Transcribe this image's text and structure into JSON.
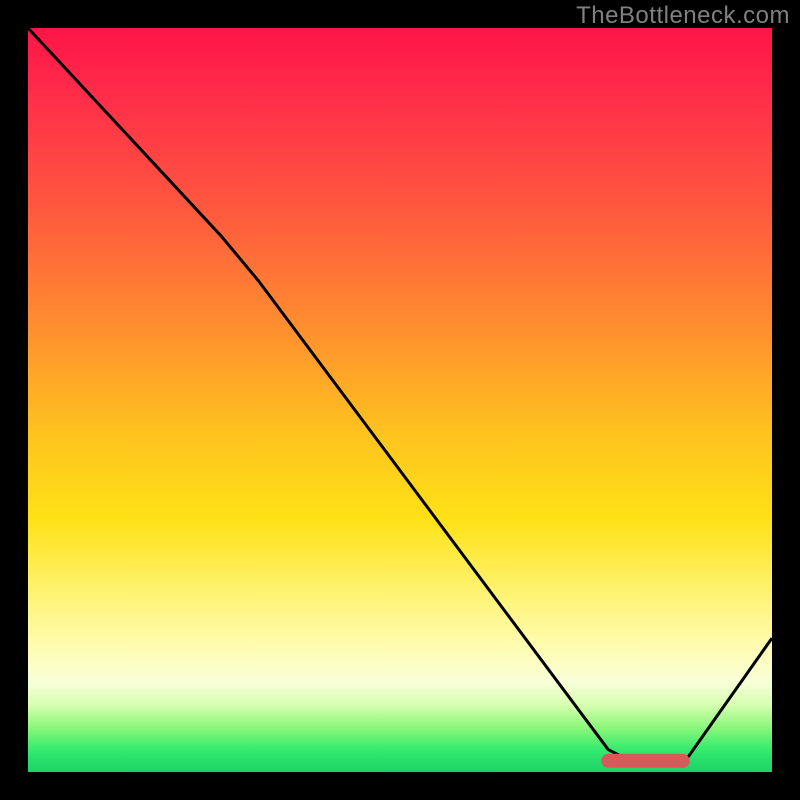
{
  "watermark": "TheBottleneck.com",
  "chart_data": {
    "type": "line",
    "title": "",
    "xlabel": "",
    "ylabel": "",
    "xlim": [
      0,
      100
    ],
    "ylim": [
      0,
      100
    ],
    "grid": false,
    "curve": [
      {
        "x": 0,
        "y": 100
      },
      {
        "x": 26,
        "y": 72
      },
      {
        "x": 31,
        "y": 66
      },
      {
        "x": 78,
        "y": 3
      },
      {
        "x": 82,
        "y": 1
      },
      {
        "x": 88,
        "y": 1
      },
      {
        "x": 100,
        "y": 18
      }
    ],
    "optimal_marker": {
      "x_start": 78,
      "x_end": 88,
      "y": 1.5,
      "color": "#d65a5a"
    },
    "background": "rainbow-vertical-red-to-green"
  }
}
